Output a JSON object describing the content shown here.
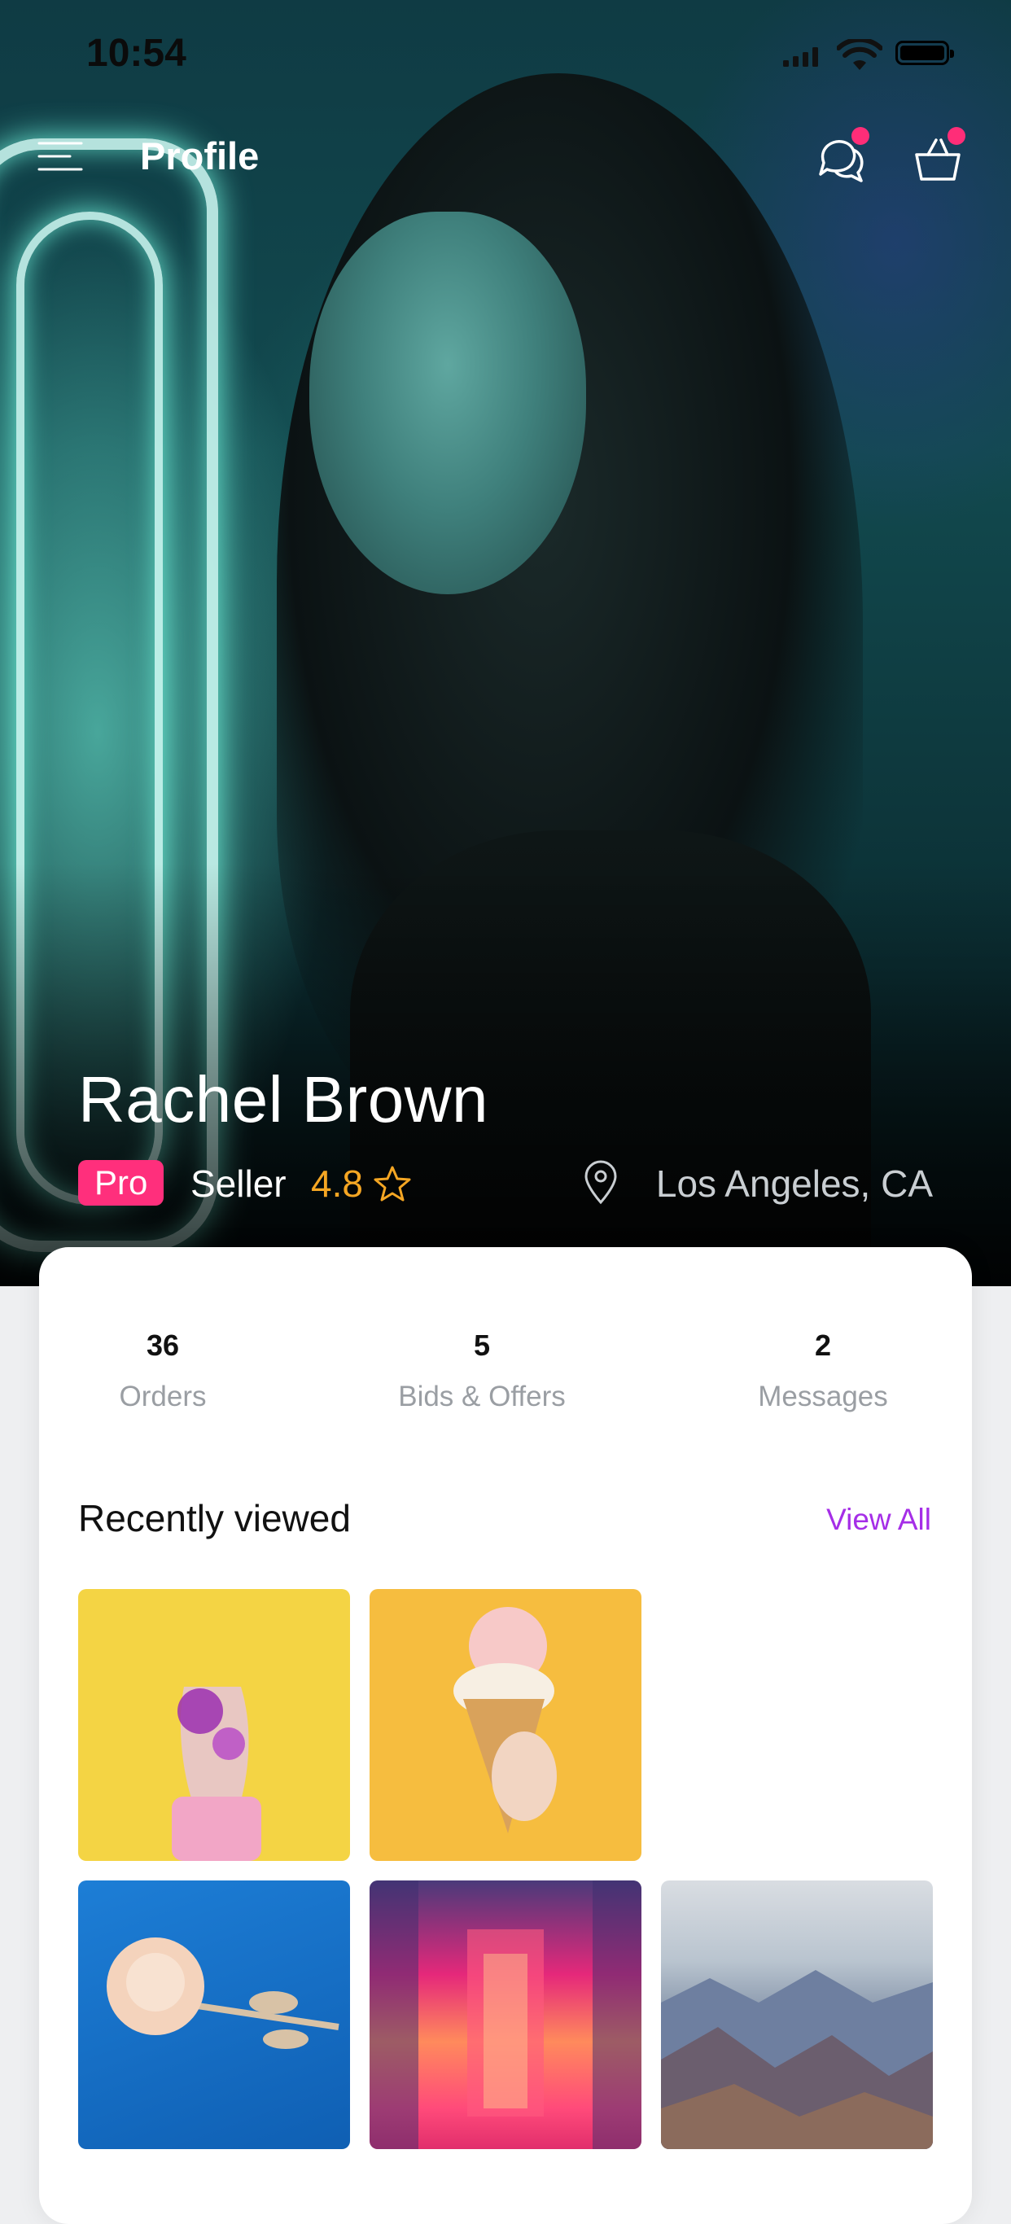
{
  "status_bar": {
    "time": "10:54"
  },
  "header": {
    "title": "Profile"
  },
  "profile": {
    "name": "Rachel Brown",
    "badge": "Pro",
    "role": "Seller",
    "rating": "4.8",
    "location": "Los Angeles, CA"
  },
  "stats": [
    {
      "value": "36",
      "label": "Orders"
    },
    {
      "value": "5",
      "label": "Bids & Offers"
    },
    {
      "value": "2",
      "label": "Messages"
    }
  ],
  "recently_viewed": {
    "title": "Recently viewed",
    "view_all_label": "View All"
  },
  "colors": {
    "accent_pink": "#ff2f7c",
    "rating_orange": "#f5a623",
    "link_purple": "#a52ee7"
  },
  "icons": {
    "menu": "menu-icon",
    "chat": "chat-icon",
    "cart": "cart-icon",
    "star": "star-icon",
    "location": "location-pin-icon"
  }
}
